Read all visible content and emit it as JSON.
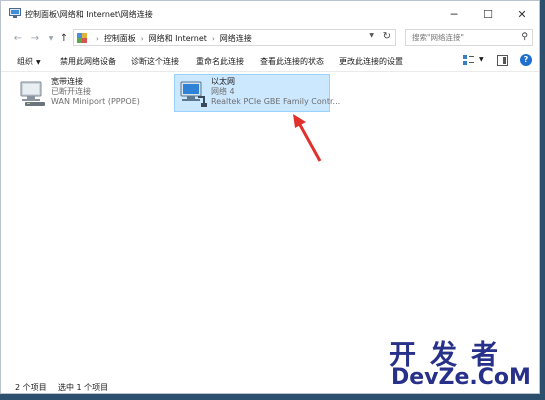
{
  "window": {
    "title": "控制面板\\网络和 Internet\\网络连接"
  },
  "address": {
    "breadcrumbs": [
      "控制面板",
      "网络和 Internet",
      "网络连接"
    ]
  },
  "search": {
    "placeholder": "搜索\"网络连接\""
  },
  "toolbar": {
    "organize": "组织",
    "disable": "禁用此网络设备",
    "diagnose": "诊断这个连接",
    "rename": "重命名此连接",
    "status": "查看此连接的状态",
    "settings": "更改此连接的设置"
  },
  "items": [
    {
      "name": "宽带连接",
      "status": "已断开连接",
      "device": "WAN Miniport (PPPOE)",
      "icon": "broadband-connection-icon",
      "selected": false
    },
    {
      "name": "以太网",
      "status": "网络 4",
      "device": "Realtek PCIe GBE Family Contr...",
      "icon": "ethernet-connection-icon",
      "selected": true
    }
  ],
  "statusbar": {
    "count": "2 个项目",
    "selected": "选中 1 个项目"
  },
  "watermark": {
    "cn": "开发者",
    "en": "DevZe.CoM"
  },
  "colors": {
    "selection_bg": "#cce8ff",
    "selection_border": "#99d1ff",
    "arrow": "#e0322d",
    "watermark": "#27318a"
  }
}
